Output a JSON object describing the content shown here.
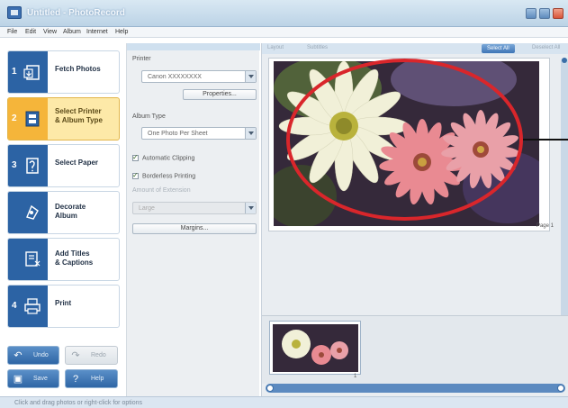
{
  "window": {
    "title": "Untitled - PhotoRecord"
  },
  "menu": {
    "items": [
      "File",
      "Edit",
      "View",
      "Album",
      "Internet",
      "Help"
    ]
  },
  "sidebar": {
    "steps": [
      {
        "number": "1",
        "label": "Fetch Photos",
        "icon": "fetch-photos-icon",
        "active": false
      },
      {
        "number": "2",
        "label": "Select Printer\n& Album Type",
        "icon": "printer-album-icon",
        "active": true
      },
      {
        "number": "3",
        "label": "Select Paper",
        "icon": "paper-icon",
        "active": false
      },
      {
        "number": "",
        "label": "Decorate\nAlbum",
        "icon": "decorate-icon",
        "active": false
      },
      {
        "number": "",
        "label": "Add Titles\n& Captions",
        "icon": "titles-captions-icon",
        "active": false
      },
      {
        "number": "4",
        "label": "Print",
        "icon": "print-icon",
        "active": false
      }
    ],
    "buttons": {
      "undo": "Undo",
      "redo": "Redo",
      "save": "Save",
      "help": "Help"
    }
  },
  "settings": {
    "printer_label": "Printer",
    "printer_value": "Canon XXXXXXXX",
    "properties_button": "Properties...",
    "album_type_label": "Album Type",
    "album_type_value": "One Photo Per Sheet",
    "auto_clipping": "Automatic Clipping",
    "borderless": "Borderless Printing",
    "amount_extension_label": "Amount of Extension",
    "amount_extension_value": "Large",
    "margins_button": "Margins..."
  },
  "preview": {
    "toolbar": {
      "item1": "Layout",
      "item2": "Subtitles",
      "select_all": "Select All",
      "deselect": "Deselect All"
    },
    "page_label": "Page 1",
    "thumb_number": "1"
  },
  "status": {
    "text": "Click and drag photos or right-click for options"
  },
  "colors": {
    "accent_blue": "#2c63a4",
    "active_step": "#f5b53a",
    "callout_red": "#d9262b"
  }
}
